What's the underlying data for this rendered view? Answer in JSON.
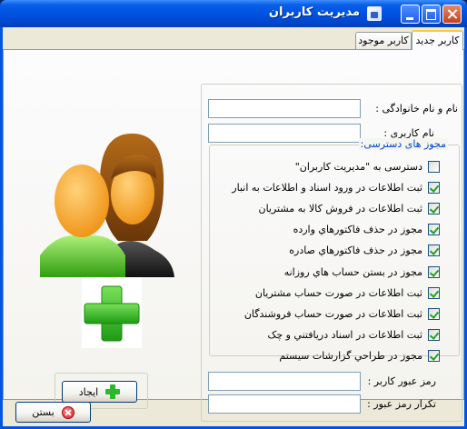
{
  "window": {
    "title": "مديريت کاربران"
  },
  "tabs": [
    {
      "label": "کاربر جديد",
      "active": true
    },
    {
      "label": "کاربر موجود",
      "active": false
    }
  ],
  "form": {
    "full_name_label": "نام و نام خانوادگی :",
    "full_name_value": "",
    "username_label": "نام کاربری :",
    "username_value": "",
    "permissions_legend": "مجوز های دسترسی:",
    "permissions": [
      {
        "label": "دسترسی به \"مديريت کاربران\"",
        "checked": false
      },
      {
        "label": "ثبت اطلاعات در ورود اسناد و اطلاعات به انبار",
        "checked": true
      },
      {
        "label": "ثبت اطلاعات در فروش کالا به مشتريان",
        "checked": true
      },
      {
        "label": "مجوز در حذف فاکتورهاي وارده",
        "checked": true
      },
      {
        "label": "مجوز در حذف فاکتورهاي صادره",
        "checked": true
      },
      {
        "label": "مجوز در بستن حساب هاي روزانه",
        "checked": true
      },
      {
        "label": "ثبت اطلاعات در صورت حساب مشتريان",
        "checked": true
      },
      {
        "label": "ثبت اطلاعات در صورت حساب فروشندگان",
        "checked": true
      },
      {
        "label": "ثبت اطلاعات در اسناد دريافتني و چک",
        "checked": true
      },
      {
        "label": "مجوز در طراحي گزارشات سيستم",
        "checked": true
      }
    ],
    "password_label": "رمز عبور کاربر :",
    "password_value": "",
    "confirm_password_label": "تکرار رمز عبور :",
    "confirm_password_value": ""
  },
  "buttons": {
    "create_label": "ايجاد",
    "close_label": "بستن"
  },
  "colors": {
    "titlebar": "#0054e3",
    "legend": "#0046d5",
    "check": "#21a121",
    "plus": "#2fb62f"
  }
}
